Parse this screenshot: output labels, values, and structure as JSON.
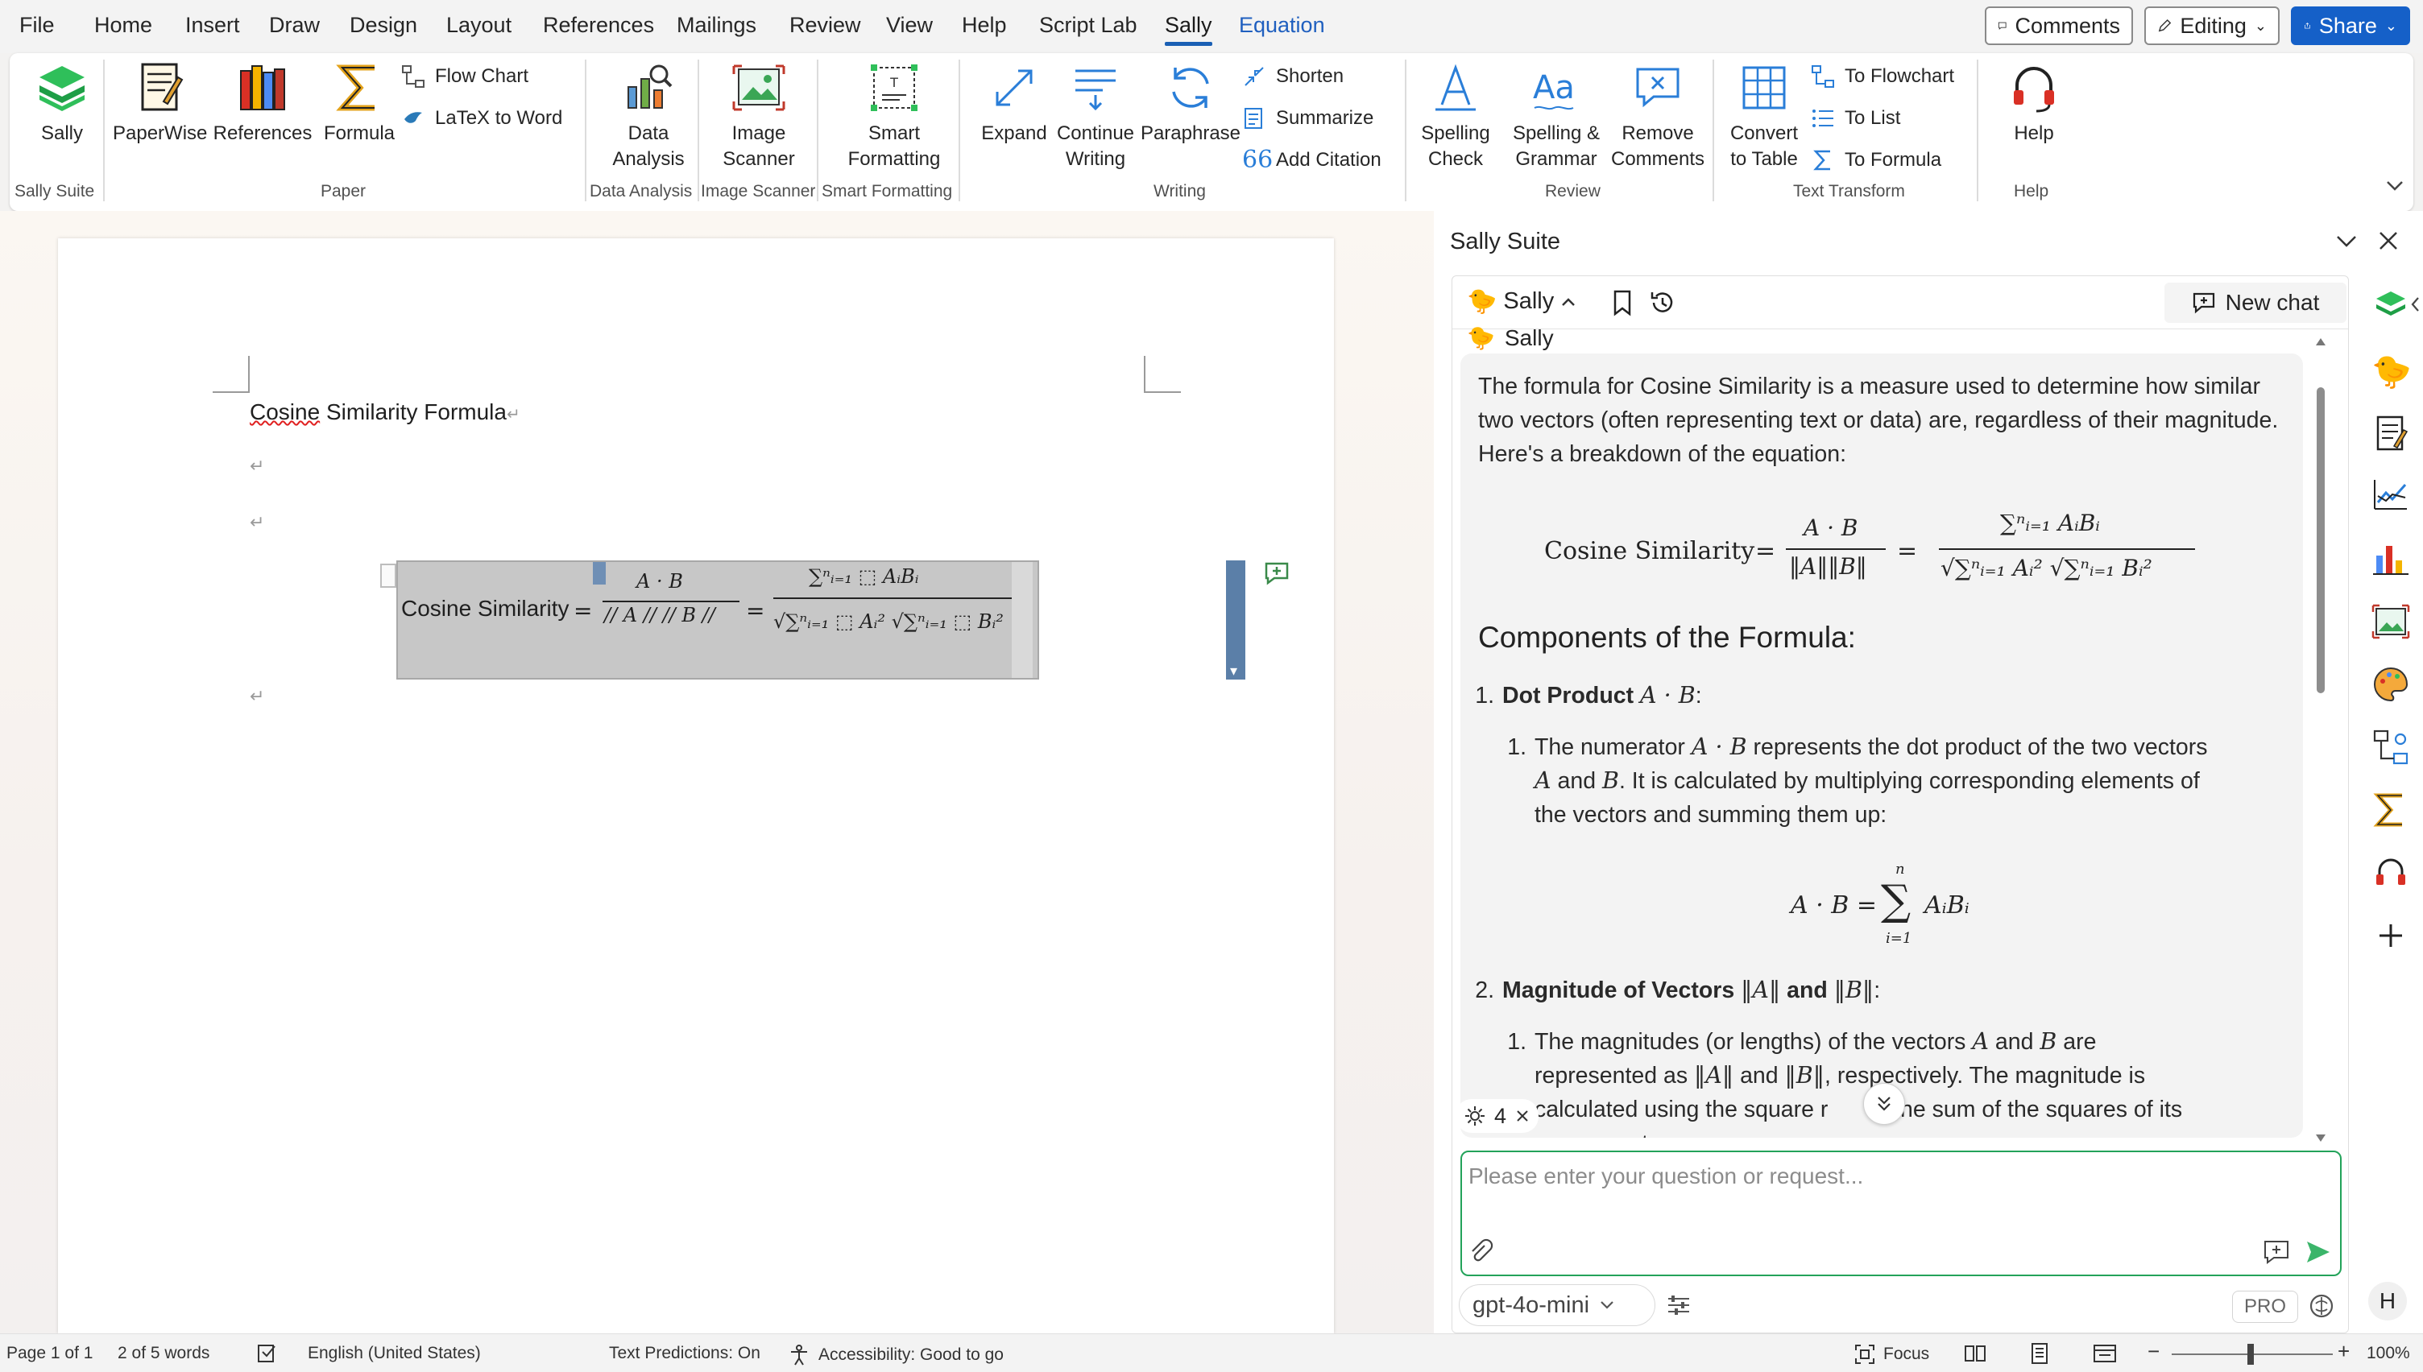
{
  "menubar": {
    "items": [
      "File",
      "Home",
      "Insert",
      "Draw",
      "Design",
      "Layout",
      "References",
      "Mailings",
      "Review",
      "View",
      "Help",
      "Script Lab",
      "Sally",
      "Equation"
    ],
    "comments_label": "Comments",
    "editing_label": "Editing",
    "share_label": "Share"
  },
  "ribbon": {
    "sally": "Sally",
    "paperwise": "PaperWise",
    "references": "References",
    "formula": "Formula",
    "flow_chart": "Flow Chart",
    "latex_to_word": "LaTeX to Word",
    "data_analysis_1": "Data",
    "data_analysis_2": "Analysis",
    "image_scanner_1": "Image",
    "image_scanner_2": "Scanner",
    "smart_formatting_1": "Smart",
    "smart_formatting_2": "Formatting",
    "expand": "Expand",
    "continue_writing_1": "Continue",
    "continue_writing_2": "Writing",
    "paraphrase": "Paraphrase",
    "shorten": "Shorten",
    "summarize": "Summarize",
    "add_citation": "Add Citation",
    "spelling_check_1": "Spelling",
    "spelling_check_2": "Check",
    "spelling_grammar_1": "Spelling &",
    "spelling_grammar_2": "Grammar",
    "remove_comments_1": "Remove",
    "remove_comments_2": "Comments",
    "convert_table_1": "Convert",
    "convert_table_2": "to Table",
    "to_flowchart": "To Flowchart",
    "to_list": "To List",
    "to_formula": "To Formula",
    "help": "Help",
    "groups": {
      "sally_suite": "Sally Suite",
      "paper": "Paper",
      "data_analysis": "Data Analysis",
      "image_scanner": "Image Scanner",
      "smart_formatting": "Smart Formatting",
      "writing": "Writing",
      "review": "Review",
      "text_transform": "Text Transform",
      "help": "Help"
    }
  },
  "document": {
    "title_word1": "Cosine",
    "title_rest": " Similarity Formula",
    "eq_label": "Cosine Similarity",
    "eq_lhs_num": "A · B",
    "eq_lhs_den": "// A // // B //",
    "eq_rhs_num": "∑ⁿᵢ₌₁ ⬚ AᵢBᵢ",
    "eq_rhs_den": "√∑ⁿᵢ₌₁ ⬚ Aᵢ² √∑ⁿᵢ₌₁ ⬚ Bᵢ²"
  },
  "panel": {
    "title": "Sally Suite",
    "agent_name": "Sally",
    "new_chat": "New chat",
    "message_author": "Sally",
    "intro": "The formula for Cosine Similarity is a measure used to determine how similar two vectors (often representing text or data) are, regardless of their magnitude. Here's a breakdown of the equation:",
    "formula_label": "Cosine Similarity",
    "heading_components": "Components of the Formula:",
    "item1_num": "1.",
    "item1_title": "Dot Product",
    "item1_math": "A · B",
    "item1_sub_num": "1.",
    "item1_sub_a": "The numerator",
    "item1_sub_b": "represents the dot product of the two vectors",
    "item1_sub_c": "and",
    "item1_sub_d": ". It is calculated by multiplying corresponding elements of",
    "item1_sub_e": "the vectors and summing them up:",
    "item2_num": "2.",
    "item2_title": "Magnitude of Vectors",
    "item2_and": "and",
    "item2_sub_num": "1.",
    "item2_sub_a": "The magnitudes (or lengths) of the vectors",
    "item2_sub_b": "and",
    "item2_sub_c": "are",
    "item2_sub_d": "represented as",
    "item2_sub_e": "and",
    "item2_sub_f": ", respectively. The magnitude is",
    "item2_sub_g": "calculated using the square r",
    "item2_sub_h": "of the sum of the squares of its",
    "item2_sub_i": "components:",
    "tools_count": "4",
    "input_placeholder": "Please enter your question or request...",
    "model": "gpt-4o-mini",
    "pro": "PRO",
    "avatar_initial": "H"
  },
  "status": {
    "page": "Page 1 of 1",
    "words": "2 of 5 words",
    "language": "English (United States)",
    "predictions": "Text Predictions: On",
    "accessibility": "Accessibility: Good to go",
    "focus": "Focus",
    "zoom": "100%"
  }
}
